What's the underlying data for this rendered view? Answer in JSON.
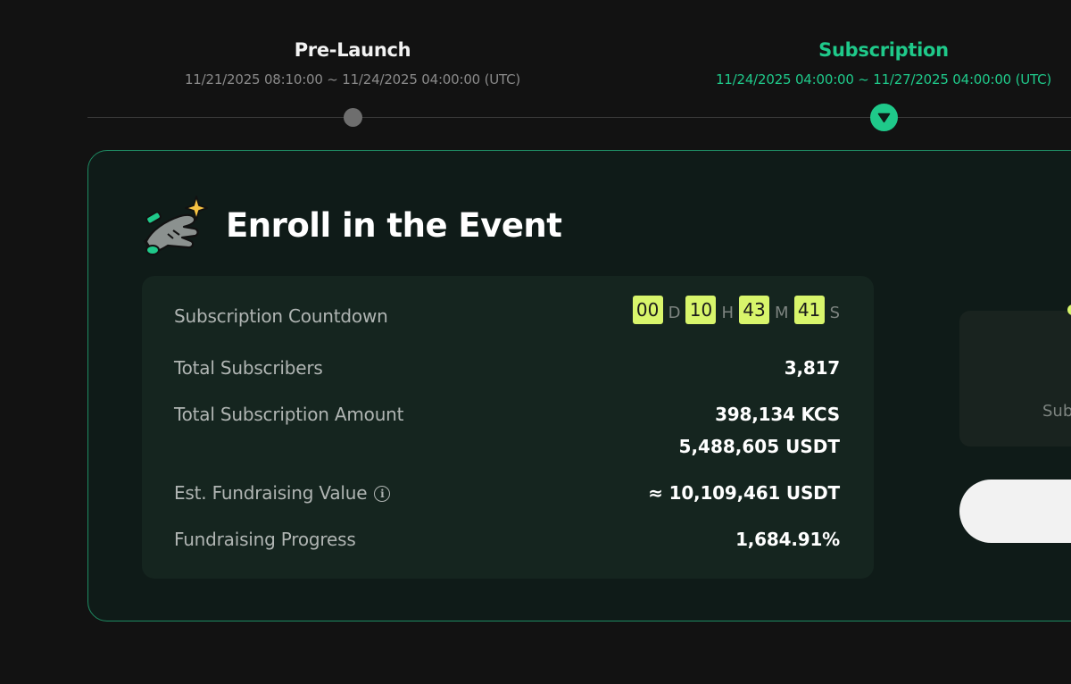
{
  "timeline": {
    "phases": [
      {
        "title": "Pre-Launch",
        "date": "11/21/2025 08:10:00 ~ 11/24/2025 04:00:00 (UTC)",
        "state": "past"
      },
      {
        "title": "Subscription",
        "date": "11/24/2025 04:00:00 ~ 11/27/2025 04:00:00 (UTC)",
        "state": "current"
      }
    ]
  },
  "card": {
    "title": "Enroll in the Event",
    "icon": "hand-sparkle-icon"
  },
  "stats": {
    "countdown": {
      "label": "Subscription Countdown",
      "days": "00",
      "days_unit": "D",
      "hours": "10",
      "hours_unit": "H",
      "minutes": "43",
      "minutes_unit": "M",
      "seconds": "41",
      "seconds_unit": "S"
    },
    "subscribers": {
      "label": "Total Subscribers",
      "value": "3,817"
    },
    "amount": {
      "label": "Total Subscription Amount",
      "value_kcs": "398,134 KCS",
      "value_usdt": "5,488,605 USDT"
    },
    "fundraising_value": {
      "label": "Est. Fundraising Value",
      "value": "≈ 10,109,461 USDT",
      "info_icon": "info-icon"
    },
    "progress": {
      "label": "Fundraising Progress",
      "value": "1,684.91%"
    }
  },
  "right_panel": {
    "partial_text": "Sub"
  },
  "colors": {
    "accent_green": "#1fc98a",
    "countdown_highlight": "#d8f56b",
    "background": "#121212",
    "card_background": "#0f1b18"
  }
}
